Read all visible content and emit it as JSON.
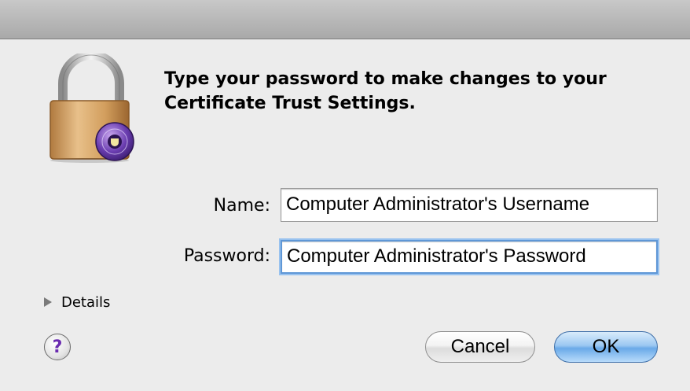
{
  "dialog": {
    "message_line1": "Type your password to make changes to your",
    "message_line2": "Certificate Trust Settings."
  },
  "form": {
    "name_label": "Name:",
    "name_value": "Computer Administrator's Username",
    "password_label": "Password:",
    "password_value": "Computer Administrator's Password"
  },
  "details": {
    "label": "Details"
  },
  "help": {
    "glyph": "?"
  },
  "buttons": {
    "cancel": "Cancel",
    "ok": "OK"
  },
  "icons": {
    "lock": "padlock-certificate-icon",
    "disclosure": "disclosure-triangle-right-icon"
  },
  "colors": {
    "focus_ring": "#5f97d6",
    "ok_button": "#6aa9e8",
    "help_glyph": "#6a2bb0"
  }
}
